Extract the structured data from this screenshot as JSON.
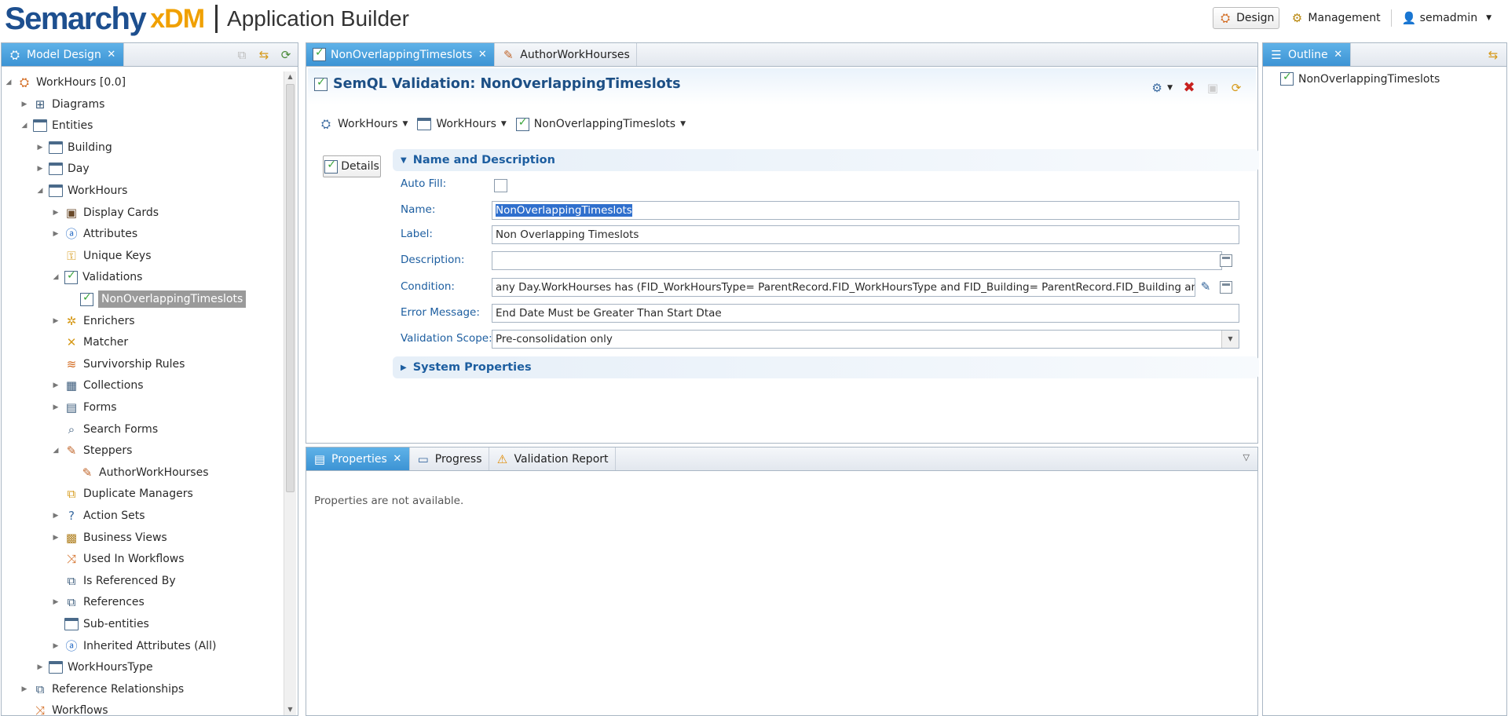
{
  "header": {
    "brand": "Semarchy",
    "product": "xDM",
    "app_title": "Application Builder",
    "design_label": "Design",
    "management_label": "Management",
    "user_label": "semadmin"
  },
  "model_panel": {
    "tab_label": "Model Design",
    "tree": [
      {
        "label": "WorkHours [0.0]",
        "icon": "model-icon",
        "twist": "expanded"
      },
      {
        "label": "Diagrams",
        "icon": "diagram-icon",
        "twist": "collapsed"
      },
      {
        "label": "Entities",
        "icon": "entity-icon",
        "twist": "expanded"
      },
      {
        "label": "Building",
        "icon": "entity-icon",
        "twist": "collapsed"
      },
      {
        "label": "Day",
        "icon": "entity-icon",
        "twist": "collapsed"
      },
      {
        "label": "WorkHours",
        "icon": "entity-icon",
        "twist": "expanded"
      },
      {
        "label": "Display Cards",
        "icon": "card-icon",
        "twist": "collapsed"
      },
      {
        "label": "Attributes",
        "icon": "attribute-icon",
        "twist": "collapsed"
      },
      {
        "label": "Unique Keys",
        "icon": "key-icon",
        "twist": "none"
      },
      {
        "label": "Validations",
        "icon": "validation-icon",
        "twist": "expanded"
      },
      {
        "label": "NonOverlappingTimeslots",
        "icon": "validation-icon",
        "twist": "none"
      },
      {
        "label": "Enrichers",
        "icon": "enricher-icon",
        "twist": "collapsed"
      },
      {
        "label": "Matcher",
        "icon": "matcher-icon",
        "twist": "none"
      },
      {
        "label": "Survivorship Rules",
        "icon": "survivorship-icon",
        "twist": "none"
      },
      {
        "label": "Collections",
        "icon": "collection-icon",
        "twist": "collapsed"
      },
      {
        "label": "Forms",
        "icon": "form-icon",
        "twist": "collapsed"
      },
      {
        "label": "Search Forms",
        "icon": "search-form-icon",
        "twist": "none"
      },
      {
        "label": "Steppers",
        "icon": "stepper-icon",
        "twist": "expanded"
      },
      {
        "label": "AuthorWorkHourses",
        "icon": "stepper-icon",
        "twist": "none"
      },
      {
        "label": "Duplicate Managers",
        "icon": "duplicate-icon",
        "twist": "none"
      },
      {
        "label": "Action Sets",
        "icon": "action-set-icon",
        "twist": "collapsed"
      },
      {
        "label": "Business Views",
        "icon": "business-view-icon",
        "twist": "collapsed"
      },
      {
        "label": "Used In Workflows",
        "icon": "workflow-icon",
        "twist": "none"
      },
      {
        "label": "Is Referenced By",
        "icon": "reference-icon",
        "twist": "none"
      },
      {
        "label": "References",
        "icon": "reference-icon",
        "twist": "collapsed"
      },
      {
        "label": "Sub-entities",
        "icon": "entity-icon",
        "twist": "none"
      },
      {
        "label": "Inherited Attributes (All)",
        "icon": "attribute-icon",
        "twist": "collapsed"
      },
      {
        "label": "WorkHoursType",
        "icon": "entity-icon",
        "twist": "collapsed"
      },
      {
        "label": "Reference Relationships",
        "icon": "reference-icon",
        "twist": "collapsed"
      },
      {
        "label": "Workflows",
        "icon": "workflow-icon",
        "twist": "none"
      }
    ]
  },
  "editor": {
    "tabs": [
      "NonOverlappingTimeslots",
      "AuthorWorkHourses"
    ],
    "title": "SemQL Validation: NonOverlappingTimeslots",
    "breadcrumb": [
      "WorkHours",
      "WorkHours",
      "NonOverlappingTimeslots"
    ],
    "details_label": "Details",
    "section_name": "Name and Description",
    "section_system": "System Properties",
    "fields": {
      "autofill_label": "Auto Fill:",
      "name_label": "Name:",
      "name_value": "NonOverlappingTimeslots",
      "label_label": "Label:",
      "label_value": "Non Overlapping Timeslots",
      "description_label": "Description:",
      "description_value": "",
      "condition_label": "Condition:",
      "condition_value": "any Day.WorkHourses has (FID_WorkHoursType= ParentRecord.FID_WorkHoursType  and FID_Building= ParentRecord.FID_Building  and (    to_",
      "error_label": "Error Message:",
      "error_value": "End Date Must be Greater Than Start Dtae",
      "scope_label": "Validation Scope:",
      "scope_value": "Pre-consolidation only"
    }
  },
  "bottom": {
    "tabs": [
      "Properties",
      "Progress",
      "Validation Report"
    ],
    "message": "Properties are not available."
  },
  "outline": {
    "tab_label": "Outline",
    "item": "NonOverlappingTimeslots"
  }
}
